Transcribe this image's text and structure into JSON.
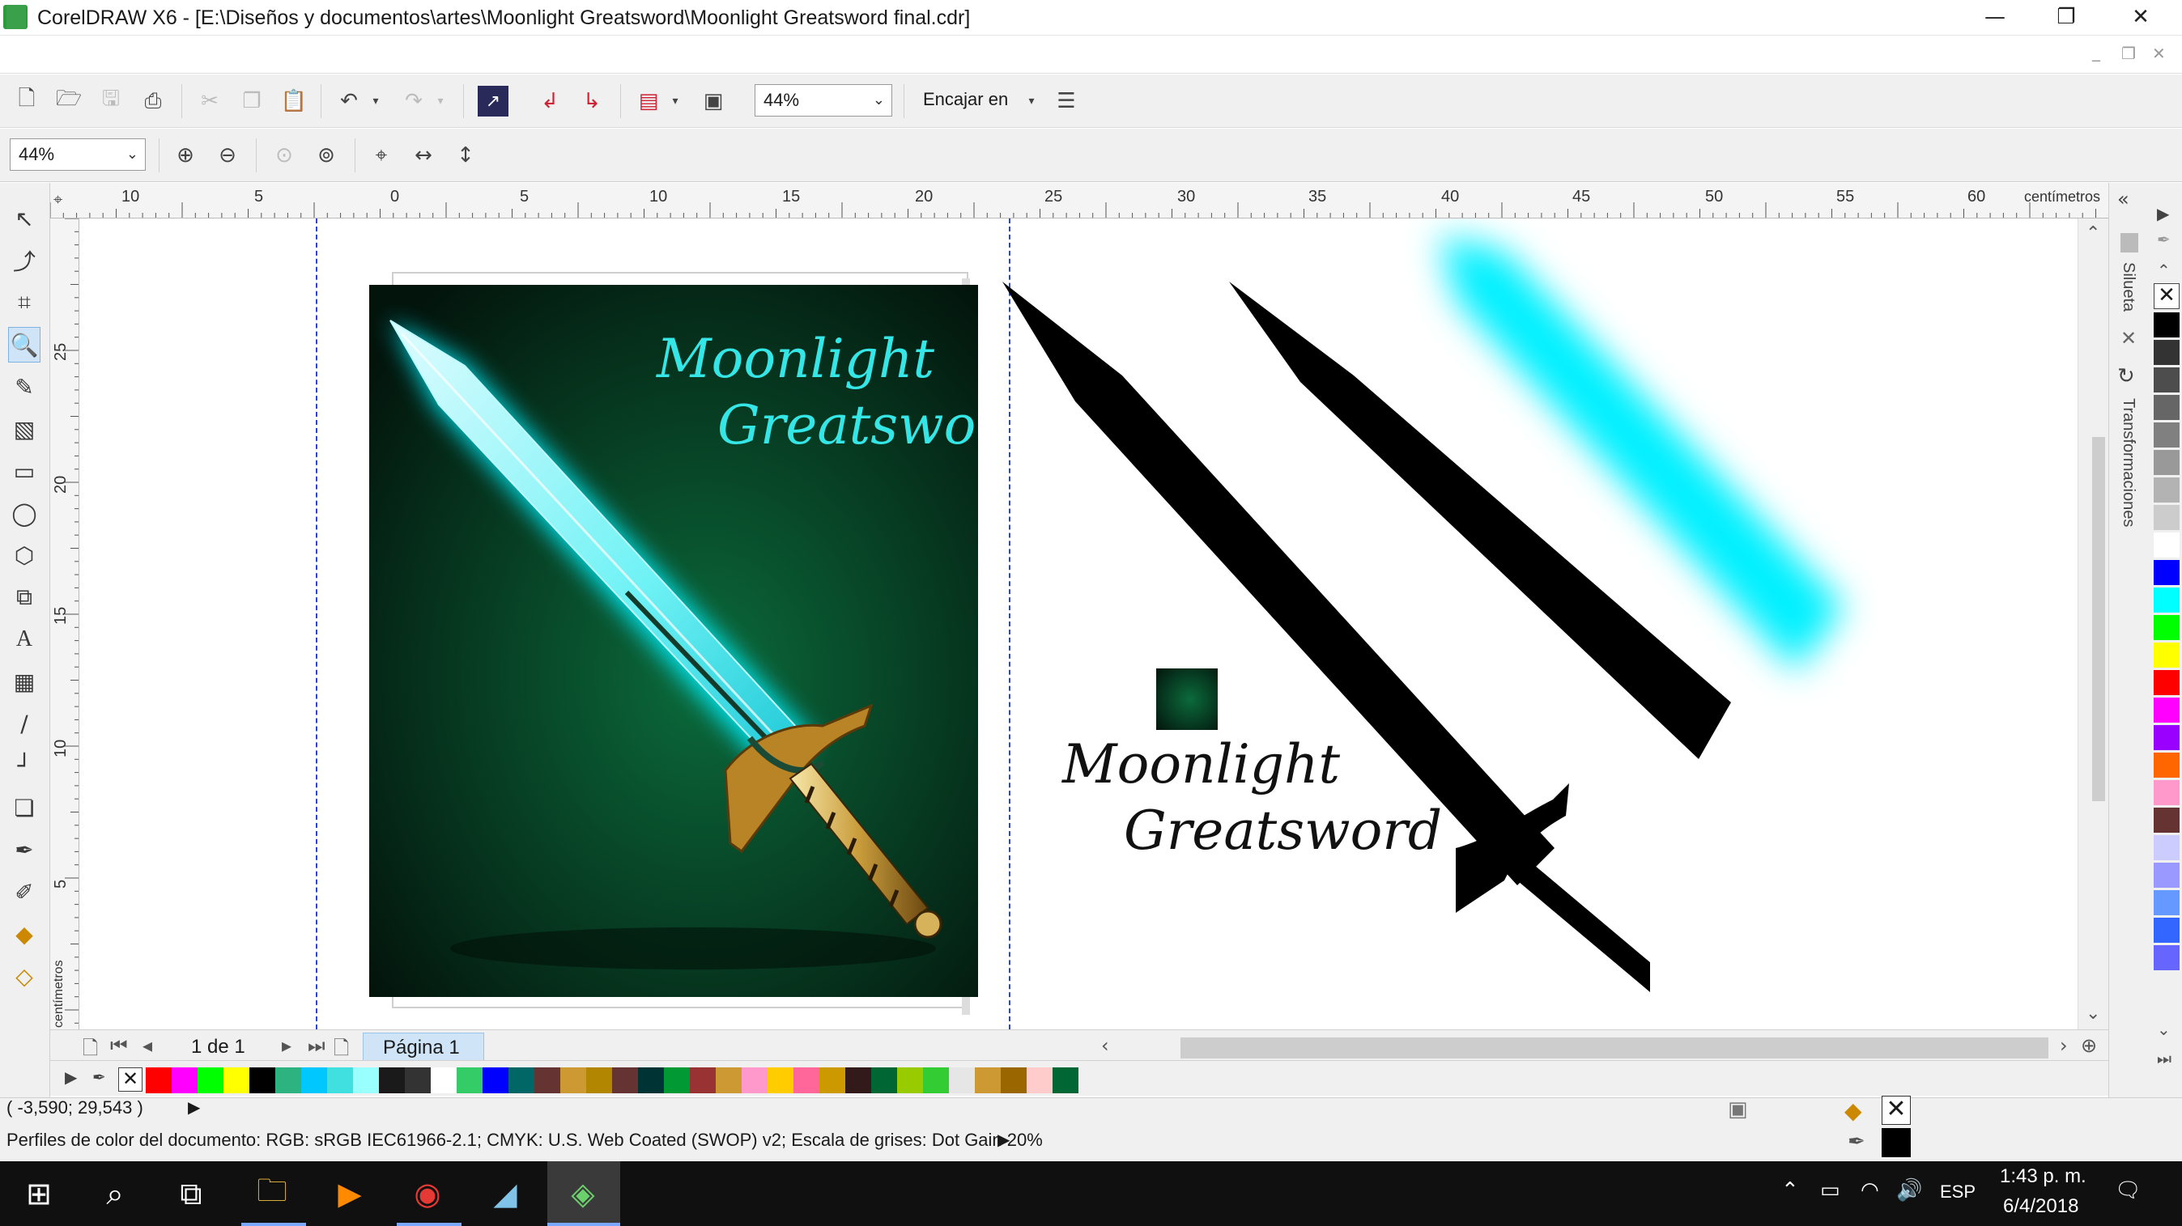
{
  "window": {
    "title": "CorelDRAW X6 - [E:\\Diseños y documentos\\artes\\Moonlight Greatsword\\Moonlight Greatsword final.cdr]",
    "minimize": "—",
    "restore": "❐",
    "close": "✕"
  },
  "doc_controls": {
    "minimize": "_",
    "restore": "❐",
    "close": "✕"
  },
  "standard_toolbar": {
    "zoom_value": "44%",
    "snap_label": "Encajar en",
    "icons": [
      "new-document-icon",
      "open-icon",
      "save-icon",
      "print-icon",
      "cut-icon",
      "copy-icon",
      "paste-icon",
      "undo-icon",
      "redo-icon",
      "corel-connect-icon",
      "import-icon",
      "export-icon",
      "publish-pdf-icon",
      "application-launcher-icon",
      "welcome-screen-icon",
      "options-icon"
    ]
  },
  "property_toolbar": {
    "zoom_value": "44%",
    "icons": [
      "zoom-in-icon",
      "zoom-out-icon",
      "zoom-selected-icon",
      "zoom-all-icon",
      "zoom-page-icon",
      "zoom-width-icon",
      "zoom-height-icon"
    ]
  },
  "toolbox": [
    "pick-tool-icon",
    "shape-tool-icon",
    "crop-tool-icon",
    "zoom-tool-icon",
    "freehand-tool-icon",
    "smart-fill-tool-icon",
    "rectangle-tool-icon",
    "ellipse-tool-icon",
    "polygon-tool-icon",
    "basic-shapes-tool-icon",
    "text-tool-icon",
    "table-tool-icon",
    "dimension-tool-icon",
    "connector-tool-icon",
    "drop-shadow-tool-icon",
    "eyedropper-tool-icon",
    "outline-pen-tool-icon",
    "fill-tool-icon",
    "interactive-fill-tool-icon"
  ],
  "ruler": {
    "h_labels": [
      "10",
      "5",
      "0",
      "5",
      "10",
      "15",
      "20",
      "25",
      "30",
      "35",
      "40",
      "45",
      "50",
      "55",
      "60"
    ],
    "v_labels": [
      "25",
      "20",
      "15",
      "10",
      "5"
    ],
    "unit": "centímetros"
  },
  "artwork": {
    "cover_title_line1": "Moonlight",
    "cover_title_line2": "Greatsword",
    "logo_line1": "Moonlight",
    "logo_line2": "Greatsword",
    "cover_colors": [
      "#0b6b3c",
      "#03140c"
    ],
    "glow_color": "#00f0ff"
  },
  "navigator": {
    "page_count": "1 de 1",
    "page_tab": "Página 1"
  },
  "dockers": {
    "silhouette": "Silueta",
    "transformations": "Transformaciones"
  },
  "palette_v": [
    "#000000",
    "#333333",
    "#4d4d4d",
    "#666666",
    "#808080",
    "#999999",
    "#b3b3b3",
    "#cccccc",
    "#ffffff",
    "#0000ff",
    "#00ffff",
    "#00ff00",
    "#ffff00",
    "#ff0000",
    "#ff00ff",
    "#9900ff",
    "#ff6600",
    "#ff99cc",
    "#663333",
    "#ccccff",
    "#9999ff",
    "#6699ff",
    "#3366ff",
    "#6666ff"
  ],
  "palette_h": [
    "#ff0000",
    "#ff00ff",
    "#00ff00",
    "#ffff00",
    "#000000",
    "#2db37f",
    "#00c8ff",
    "#40e0e0",
    "#99ffff",
    "#1a1a1a",
    "#333333",
    "#ffffff",
    "#33cc66",
    "#0000ff",
    "#006666",
    "#663333",
    "#cc9933",
    "#b38600",
    "#663333",
    "#003333",
    "#009933",
    "#993333",
    "#cc9933",
    "#ff99cc",
    "#ffcc00",
    "#ff6699",
    "#cc9900",
    "#331a1a",
    "#006633",
    "#99cc00",
    "#33cc33",
    "#e6e6e6",
    "#cc9933",
    "#996600",
    "#ffcccc",
    "#006633"
  ],
  "status": {
    "coordinates": "( -3,590; 29,543 )",
    "color_profiles": "Perfiles de color del documento: RGB: sRGB IEC61966-2.1; CMYK: U.S. Web Coated (SWOP) v2; Escala de grises: Dot Gain 20%"
  },
  "taskbar": {
    "language": "ESP",
    "time": "1:43 p. m.",
    "date": "6/4/2018"
  }
}
